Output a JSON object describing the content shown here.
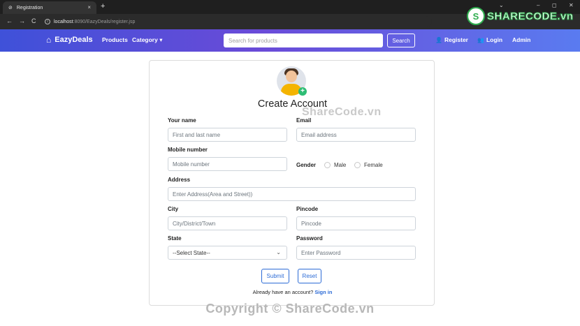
{
  "browser": {
    "tab_title": "Registration",
    "tab_close": "×",
    "new_tab": "+",
    "url_host": "localhost",
    "url_path": ":8090/EazyDeals/register.jsp",
    "back": "←",
    "forward": "→",
    "reload": "C",
    "minimize": "–",
    "restore": "◻",
    "close": "✕",
    "dropdown": "⌄"
  },
  "navbar": {
    "brand": "EazyDeals",
    "products": "Products",
    "category": "Category ▾",
    "search_placeholder": "Search for products",
    "search_button": "Search",
    "register": "Register",
    "login": "Login",
    "admin": "Admin"
  },
  "form": {
    "title": "Create Account",
    "name_label": "Your name",
    "name_placeholder": "First and last name",
    "email_label": "Email",
    "email_placeholder": "Email address",
    "mobile_label": "Mobile number",
    "mobile_placeholder": "Mobile number",
    "gender_label": "Gender",
    "gender_male": "Male",
    "gender_female": "Female",
    "address_label": "Address",
    "address_placeholder": "Enter Address(Area and Street))",
    "city_label": "City",
    "city_placeholder": "City/District/Town",
    "pincode_label": "Pincode",
    "pincode_placeholder": "Pincode",
    "state_label": "State",
    "state_selected": "--Select State--",
    "password_label": "Password",
    "password_placeholder": "Enter Password",
    "submit": "Submit",
    "reset": "Reset",
    "have_account": "Already have an account?",
    "sign_in": "Sign in"
  },
  "watermarks": {
    "logo_letter": "S",
    "logo_text": "SHARECODE.vn",
    "center": "ShareCode.vn",
    "bottom": "Copyright © ShareCode.vn"
  },
  "colors": {
    "navbar_start": "#3f51d9",
    "navbar_end": "#5a7bf0",
    "accent": "#2c6bd6",
    "avatar_badge": "#2dbd74"
  }
}
